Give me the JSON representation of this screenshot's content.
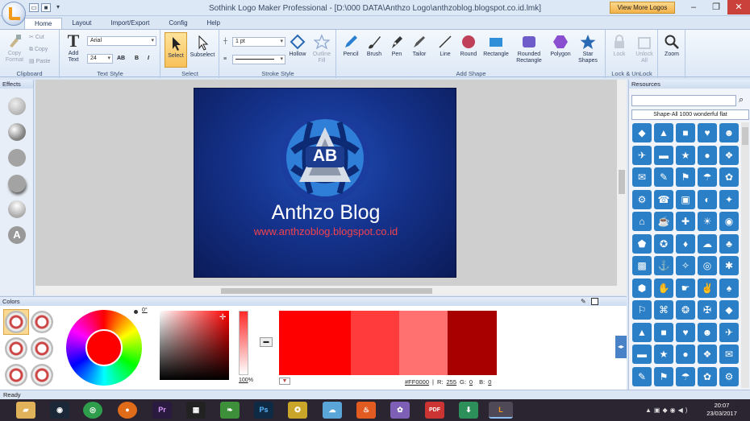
{
  "window": {
    "title": "Sothink Logo Maker Professional - [D:\\000 DATA\\Anthzo Logo\\anthzoblog.blogspot.co.id.lmk]",
    "view_more": "View More Logos"
  },
  "tabs": [
    "Home",
    "Layout",
    "Import/Export",
    "Config",
    "Help"
  ],
  "ribbon": {
    "clipboard": {
      "label": "Clipboard",
      "copy_format": "Copy Format",
      "cut": "Cut",
      "copy": "Copy",
      "paste": "Paste"
    },
    "text_style": {
      "label": "Text Style",
      "add_text": "Add Text",
      "font": "Arial",
      "size": "24",
      "bold": "B",
      "italic": "I"
    },
    "select": {
      "label": "Select",
      "select": "Select",
      "subselect": "Subselect"
    },
    "stroke": {
      "label": "Stroke Style",
      "width": "1 pt",
      "hollow": "Hollow",
      "outline_fill": "Outline Fill"
    },
    "add_shape": {
      "label": "Add Shape",
      "pencil": "Pencil",
      "brush": "Brush",
      "pen": "Pen",
      "tailor": "Tailor",
      "line": "Line",
      "round": "Round",
      "rectangle": "Rectangle",
      "rounded_rectangle": "Rounded Rectangle",
      "polygon": "Polygon",
      "star_shapes": "Star Shapes"
    },
    "lock": {
      "label": "Lock & UnLock",
      "lock": "Lock",
      "unlock_all": "Unlock All"
    },
    "zoom": {
      "zoom": "Zoom"
    }
  },
  "effects": {
    "title": "Effects",
    "a_label": "A"
  },
  "logo": {
    "initials": "AB",
    "name": "Anthzo Blog",
    "url": "www.anthzoblog.blogspot.co.id"
  },
  "resources": {
    "title": "Resources",
    "filter": "Shape-All 1000 wonderful flat"
  },
  "colors": {
    "title": "Colors",
    "angle": "0°",
    "brightness": "100",
    "percent": "%",
    "hex": "#FF0000",
    "r_label": "R:",
    "r": "255",
    "g_label": "G:",
    "g": "0",
    "b_label": "B:",
    "b": "0",
    "swatches": [
      "#ff0000",
      "#ff3b3b",
      "#ff7070",
      "#a80000"
    ]
  },
  "status": "Ready",
  "taskbar": {
    "time": "20:07",
    "date": "23/03/2017"
  }
}
